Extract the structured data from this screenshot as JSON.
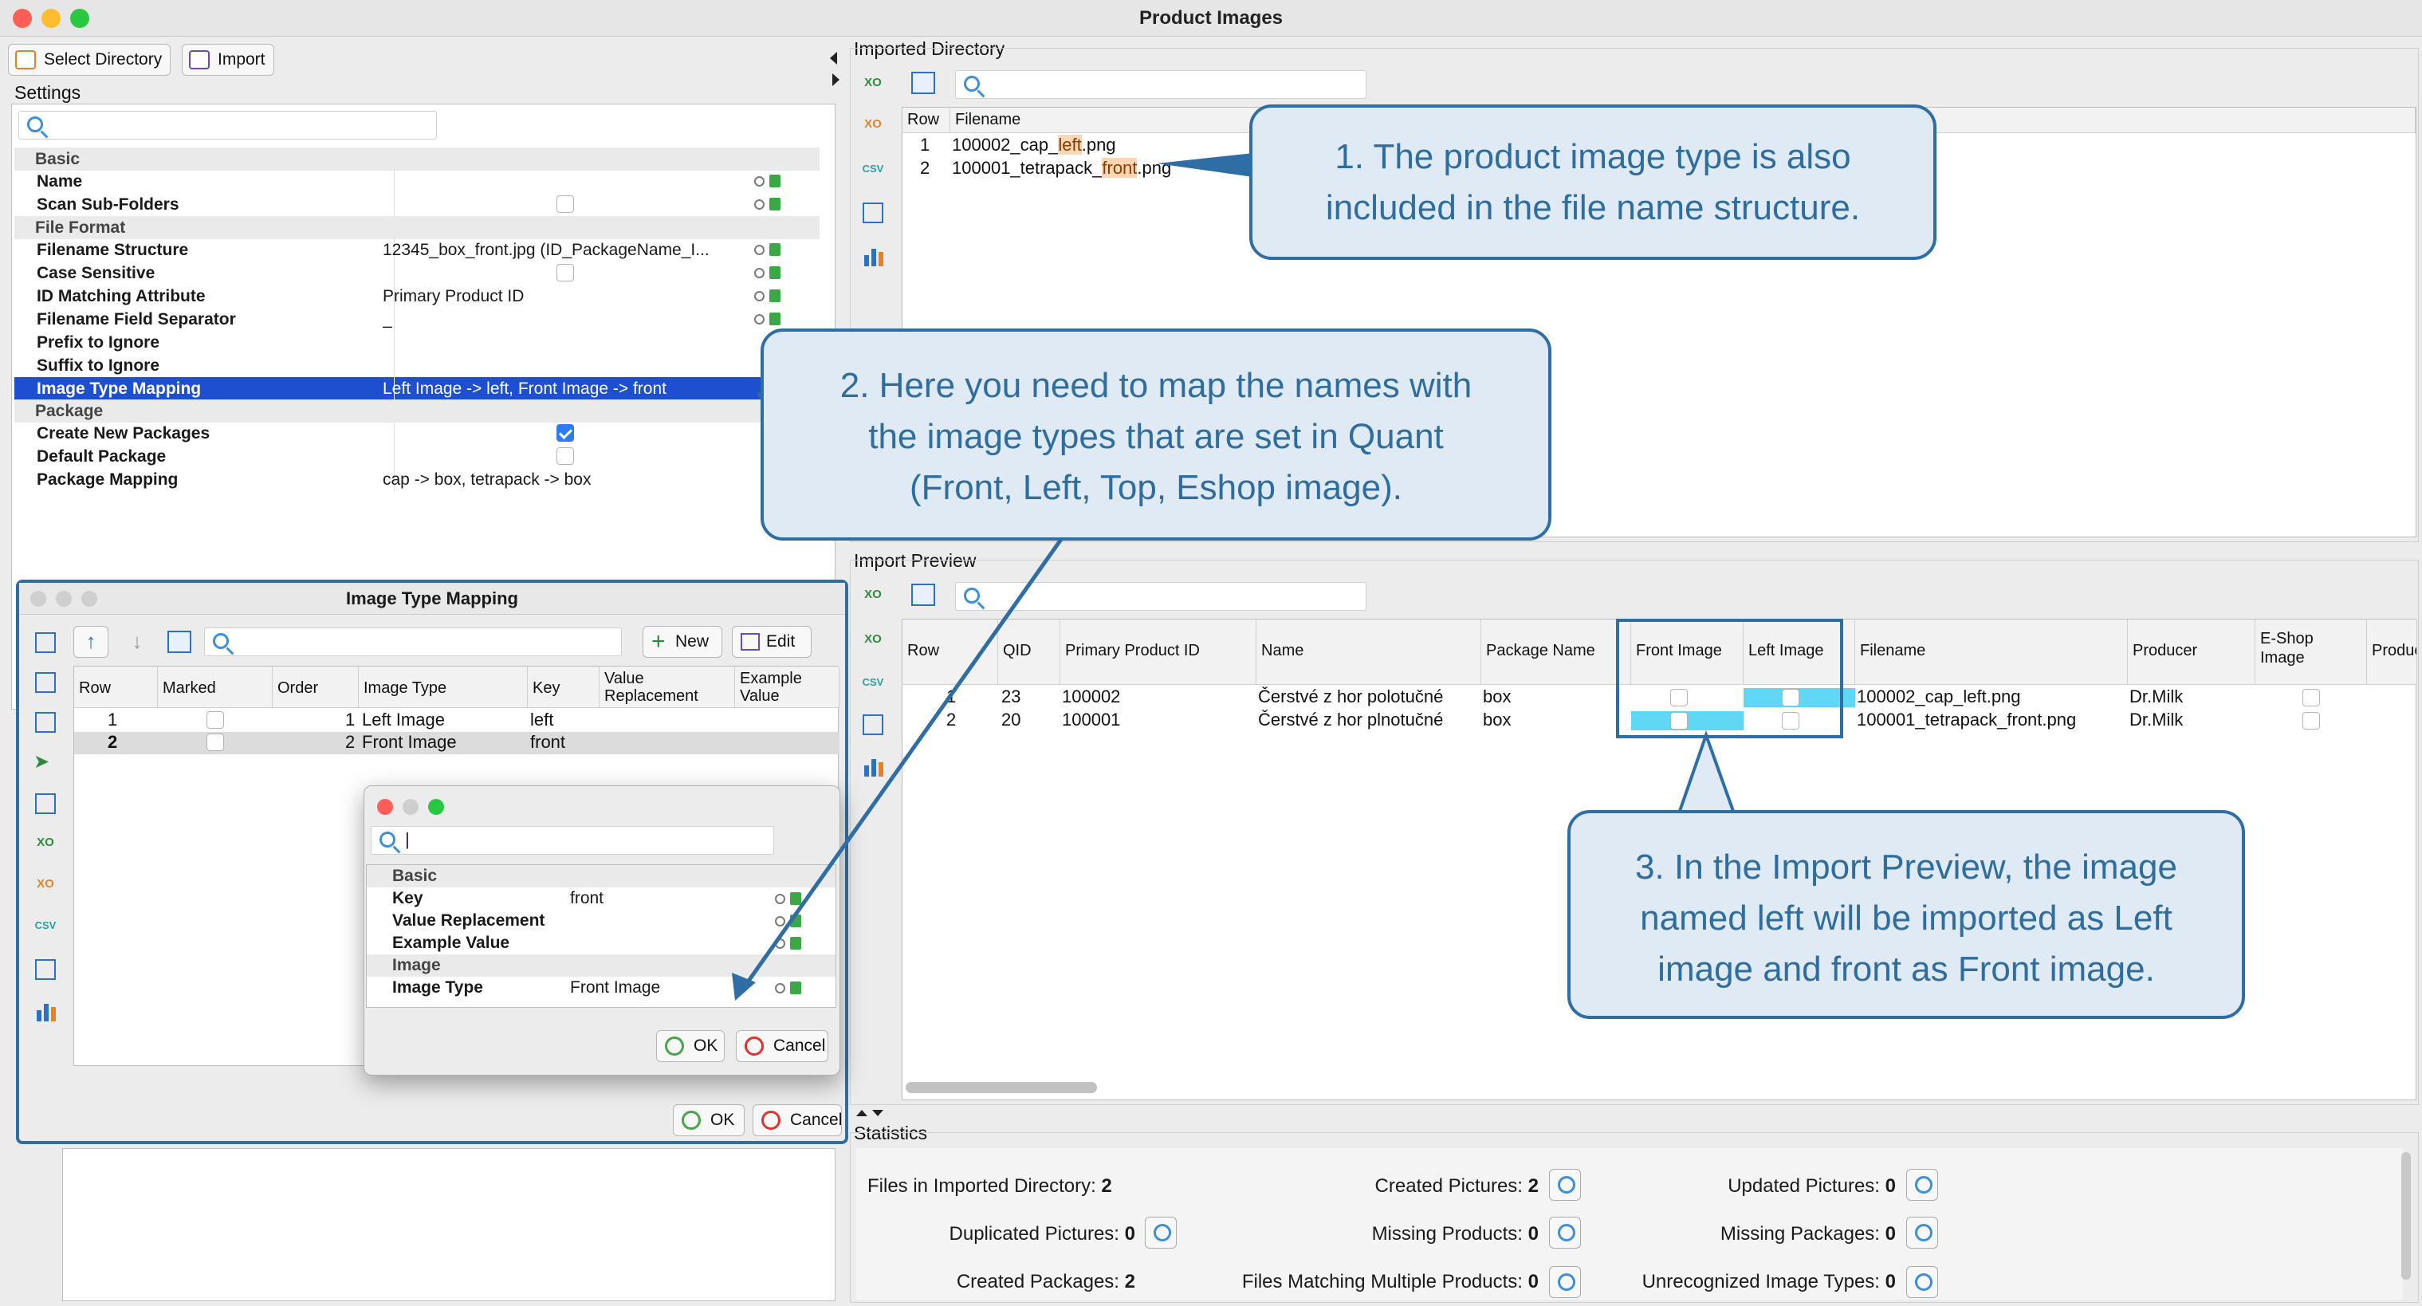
{
  "window": {
    "title": "Product Images",
    "colors": {
      "close": "#ff5f57",
      "minimize": "#febc2e",
      "zoom": "#28c840"
    }
  },
  "toolbar": {
    "select_directory": "Select Directory",
    "import": "Import"
  },
  "settings": {
    "label": "Settings",
    "groups": {
      "basic": "Basic",
      "file_format": "File Format",
      "package": "Package"
    },
    "rows": {
      "name": "Name",
      "scan_sub_folders": "Scan Sub-Folders",
      "filename_structure": "Filename Structure",
      "filename_structure_value": "12345_box_front.jpg (ID_PackageName_I...",
      "case_sensitive": "Case Sensitive",
      "id_matching_attribute": "ID Matching Attribute",
      "id_matching_attribute_value": "Primary Product ID",
      "filename_field_separator": "Filename Field Separator",
      "filename_field_separator_value": "_",
      "prefix_to_ignore": "Prefix to Ignore",
      "suffix_to_ignore": "Suffix to Ignore",
      "image_type_mapping": "Image Type Mapping",
      "image_type_mapping_value": "Left Image -> left, Front Image -> front",
      "create_new_packages": "Create New Packages",
      "default_package": "Default Package",
      "package_mapping": "Package Mapping",
      "package_mapping_value": "cap -> box, tetrapack -> box"
    }
  },
  "imported_directory": {
    "label": "Imported Directory",
    "headers": {
      "row": "Row",
      "filename": "Filename"
    },
    "rows": [
      {
        "row": "1",
        "pre": "100002_cap_",
        "hl": "left",
        "post": ".png"
      },
      {
        "row": "2",
        "pre": "100001_tetrapack_",
        "hl": "front",
        "post": ".png"
      }
    ]
  },
  "itm": {
    "title": "Image Type Mapping",
    "new": "New",
    "edit": "Edit",
    "headers": {
      "row": "Row",
      "marked": "Marked",
      "order": "Order",
      "image_type": "Image Type",
      "key": "Key",
      "value_replacement": "Value Replacement",
      "example_value": "Example Value"
    },
    "rows": [
      {
        "row": "1",
        "order": "1",
        "type": "Left Image",
        "key": "left"
      },
      {
        "row": "2",
        "order": "2",
        "type": "Front Image",
        "key": "front"
      }
    ],
    "ok": "OK",
    "cancel": "Cancel"
  },
  "editor": {
    "search_value": "|",
    "basic": "Basic",
    "key": "Key",
    "key_value": "front",
    "value_replacement": "Value Replacement",
    "example_value": "Example Value",
    "image": "Image",
    "image_type": "Image Type",
    "image_type_value": "Front Image",
    "ok": "OK",
    "cancel": "Cancel"
  },
  "import_preview": {
    "label": "Import Preview",
    "headers": {
      "row": "Row",
      "qid": "QID",
      "ppid": "Primary Product ID",
      "name": "Name",
      "package": "Package Name",
      "front": "Front Image",
      "left": "Left Image",
      "filename": "Filename",
      "producer": "Producer",
      "eshop": "E-Shop Image",
      "produc": "Produc"
    },
    "rows": [
      {
        "row": "1",
        "qid": "23",
        "ppid": "100002",
        "name": "Čerstvé z hor polotučné",
        "package": "box",
        "filename": "100002_cap_left.png",
        "producer": "Dr.Milk"
      },
      {
        "row": "2",
        "qid": "20",
        "ppid": "100001",
        "name": "Čerstvé z hor plnotučné",
        "package": "box",
        "filename": "100001_tetrapack_front.png",
        "producer": "Dr.Milk"
      }
    ]
  },
  "statistics": {
    "label": "Statistics",
    "files_in_dir": "Files in Imported Directory:",
    "files_in_dir_val": "2",
    "created_pictures": "Created Pictures:",
    "created_pictures_val": "2",
    "updated_pictures": "Updated Pictures:",
    "updated_pictures_val": "0",
    "duplicated_pictures": "Duplicated Pictures:",
    "duplicated_pictures_val": "0",
    "missing_products": "Missing Products:",
    "missing_products_val": "0",
    "missing_packages": "Missing Packages:",
    "missing_packages_val": "0",
    "created_packages": "Created Packages:",
    "created_packages_val": "2",
    "files_matching": "Files Matching Multiple Products:",
    "files_matching_val": "0",
    "unrecognized": "Unrecognized Image Types:",
    "unrecognized_val": "0"
  },
  "callouts": {
    "c1_l1": "1. The product image type is also",
    "c1_l2": "included in the file name structure.",
    "c2_l1": "2. Here you need to map the names with",
    "c2_l2": "the image types that are set in Quant",
    "c2_l3": "(Front, Left, Top, Eshop image).",
    "c3_l1": "3. In the Import Preview, the image",
    "c3_l2": "named left will be imported as Left",
    "c3_l3": "image and front as Front image."
  },
  "icons": [
    "search-icon",
    "excel-export-icon",
    "excel-import-icon",
    "csv-icon",
    "chart-icon",
    "table-settings-icon",
    "arrow-up-icon",
    "arrow-down-icon",
    "plus-icon",
    "edit-icon",
    "ok-icon",
    "cancel-icon",
    "magnifier-icon",
    "reset-icon",
    "pin-icon"
  ],
  "accent": {
    "selection": "#1f4fd1",
    "highlight_cyan": "#5fd7f5",
    "callout_border": "#2f6ea4",
    "callout_fill": "#dfeaf4"
  }
}
